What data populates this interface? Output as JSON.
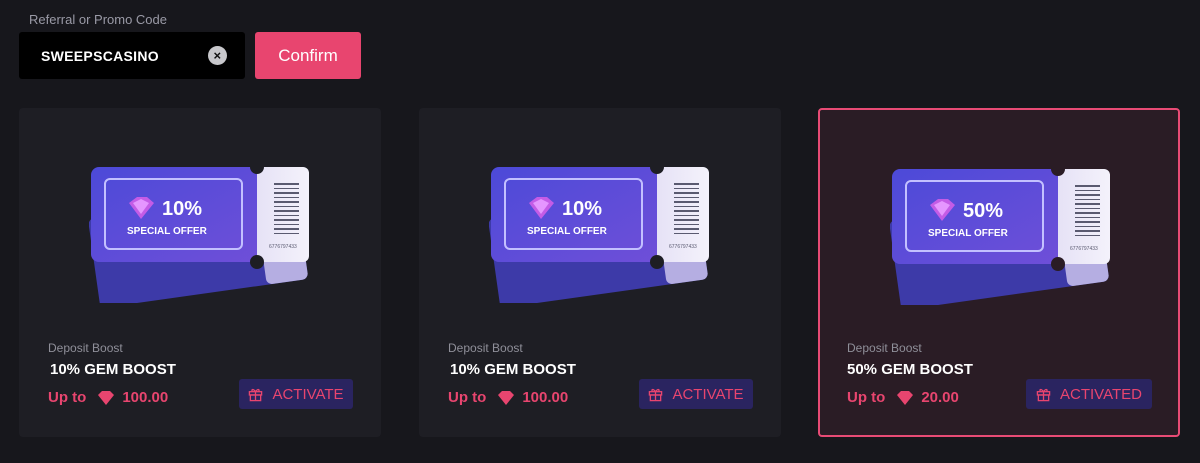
{
  "promo": {
    "label": "Referral or Promo Code",
    "value": "SWEEPSCASINO",
    "clear_icon": "close-circle-icon",
    "confirm_label": "Confirm"
  },
  "colors": {
    "accent": "#e8456f",
    "button_bg": "#2a2460",
    "card_bg": "#1e1e24",
    "page_bg": "#17171c"
  },
  "cards": [
    {
      "ticket_percent": "10%",
      "ticket_text": "SPECIAL OFFER",
      "ticket_serial": "6776797433",
      "type": "Deposit Boost",
      "title": "10% GEM BOOST",
      "upto_label": "Up to",
      "amount": "100.00",
      "button_label": "ACTIVATE",
      "active": false
    },
    {
      "ticket_percent": "10%",
      "ticket_text": "SPECIAL OFFER",
      "ticket_serial": "6776797433",
      "type": "Deposit Boost",
      "title": "10% GEM BOOST",
      "upto_label": "Up to",
      "amount": "100.00",
      "button_label": "ACTIVATE",
      "active": false
    },
    {
      "ticket_percent": "50%",
      "ticket_text": "SPECIAL OFFER",
      "ticket_serial": "6776797433",
      "type": "Deposit Boost",
      "title": "50% GEM BOOST",
      "upto_label": "Up to",
      "amount": "20.00",
      "button_label": "ACTIVATED",
      "active": true
    }
  ]
}
